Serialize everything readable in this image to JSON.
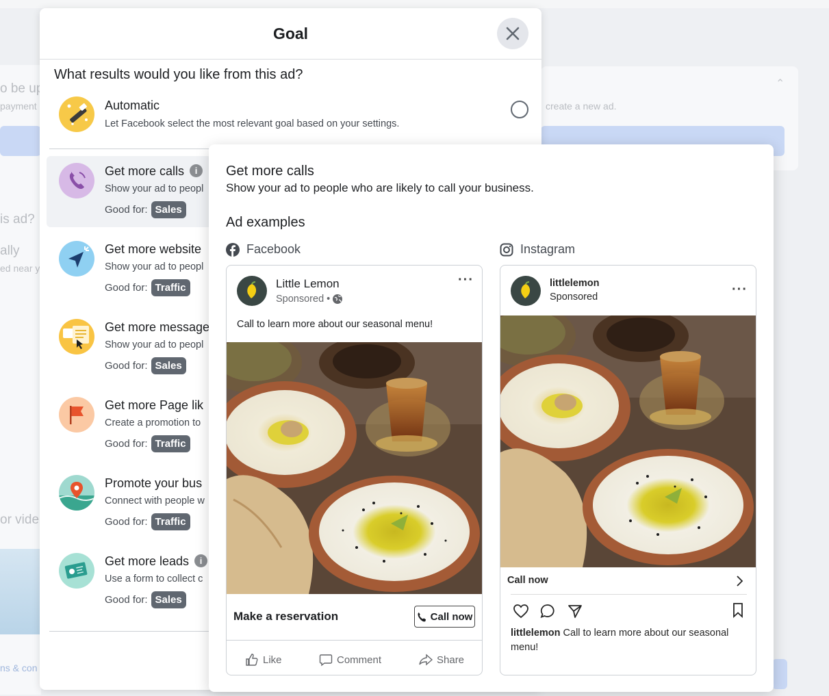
{
  "background": {
    "frag1": "o be up",
    "frag2": "payment",
    "frag3": "is ad?",
    "frag4": "ally",
    "frag5": "ed near y",
    "frag6": "or vide",
    "frag7": "ns & con",
    "frag8": "create a new ad."
  },
  "modal": {
    "title": "Goal",
    "question": "What results would you like from this ad?",
    "automatic": {
      "title": "Automatic",
      "desc": "Let Facebook select the most relevant goal based on your settings."
    },
    "good_for_label": "Good for:",
    "options": [
      {
        "title": "Get more calls",
        "desc": "Show your ad to peopl",
        "badge": "Sales"
      },
      {
        "title": "Get more website",
        "desc": "Show your ad to peopl",
        "badge": "Traffic"
      },
      {
        "title": "Get more message",
        "desc": "Show your ad to peopl",
        "badge": "Sales"
      },
      {
        "title": "Get more Page lik",
        "desc": "Create a promotion to",
        "badge": "Traffic"
      },
      {
        "title": "Promote your bus",
        "desc": "Connect with people w",
        "badge": "Traffic"
      },
      {
        "title": "Get more leads",
        "desc": "Use a form to collect c",
        "badge": "Sales"
      }
    ]
  },
  "preview": {
    "title": "Get more calls",
    "desc": "Show your ad to people who are likely to call your business.",
    "examples_heading": "Ad examples",
    "facebook": {
      "platform": "Facebook",
      "page_name": "Little Lemon",
      "sponsored": "Sponsored •",
      "caption": "Call to learn more about our seasonal menu!",
      "headline": "Make a reservation",
      "cta": "Call now",
      "like": "Like",
      "comment": "Comment",
      "share": "Share"
    },
    "instagram": {
      "platform": "Instagram",
      "handle": "littlelemon",
      "sponsored": "Sponsored",
      "cta": "Call now",
      "caption_user": "littlelemon",
      "caption_text": " Call to learn more about our seasonal menu!"
    }
  }
}
